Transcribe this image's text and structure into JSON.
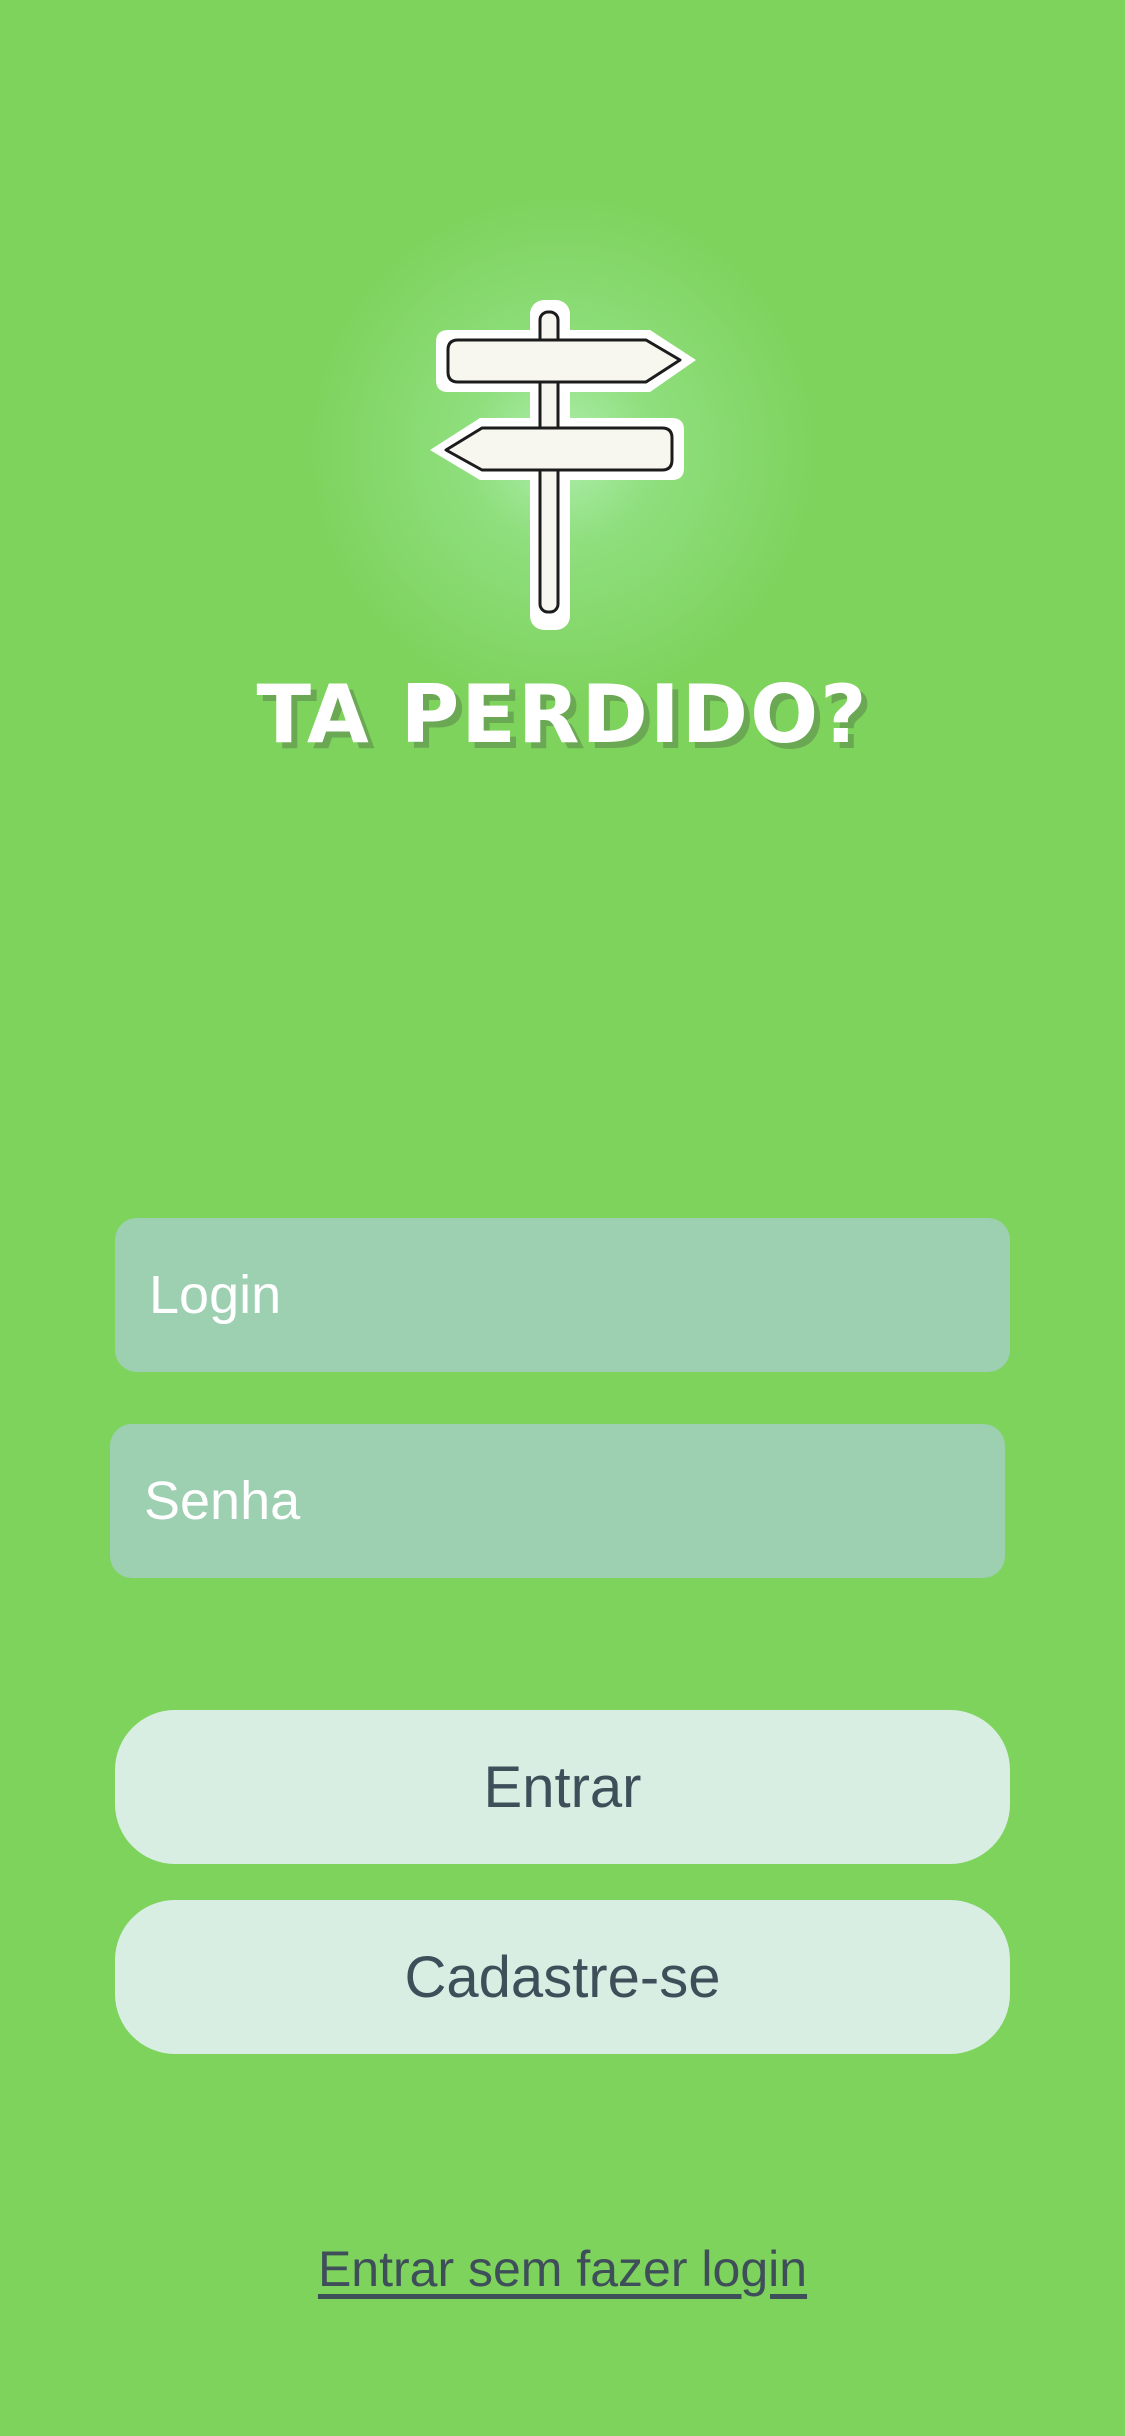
{
  "app": {
    "title": "TA PERDIDO?",
    "logo_icon": "signpost-icon"
  },
  "form": {
    "login_placeholder": "Login",
    "login_value": "",
    "password_placeholder": "Senha",
    "password_value": ""
  },
  "buttons": {
    "login_label": "Entrar",
    "signup_label": "Cadastre-se"
  },
  "links": {
    "guest_label": "Entrar sem fazer login"
  },
  "colors": {
    "background": "#7ed35d",
    "input_background": "#9dcfb1",
    "button_background": "#d9eee3",
    "button_text": "#3f4f5a",
    "title_text": "#ffffff"
  }
}
